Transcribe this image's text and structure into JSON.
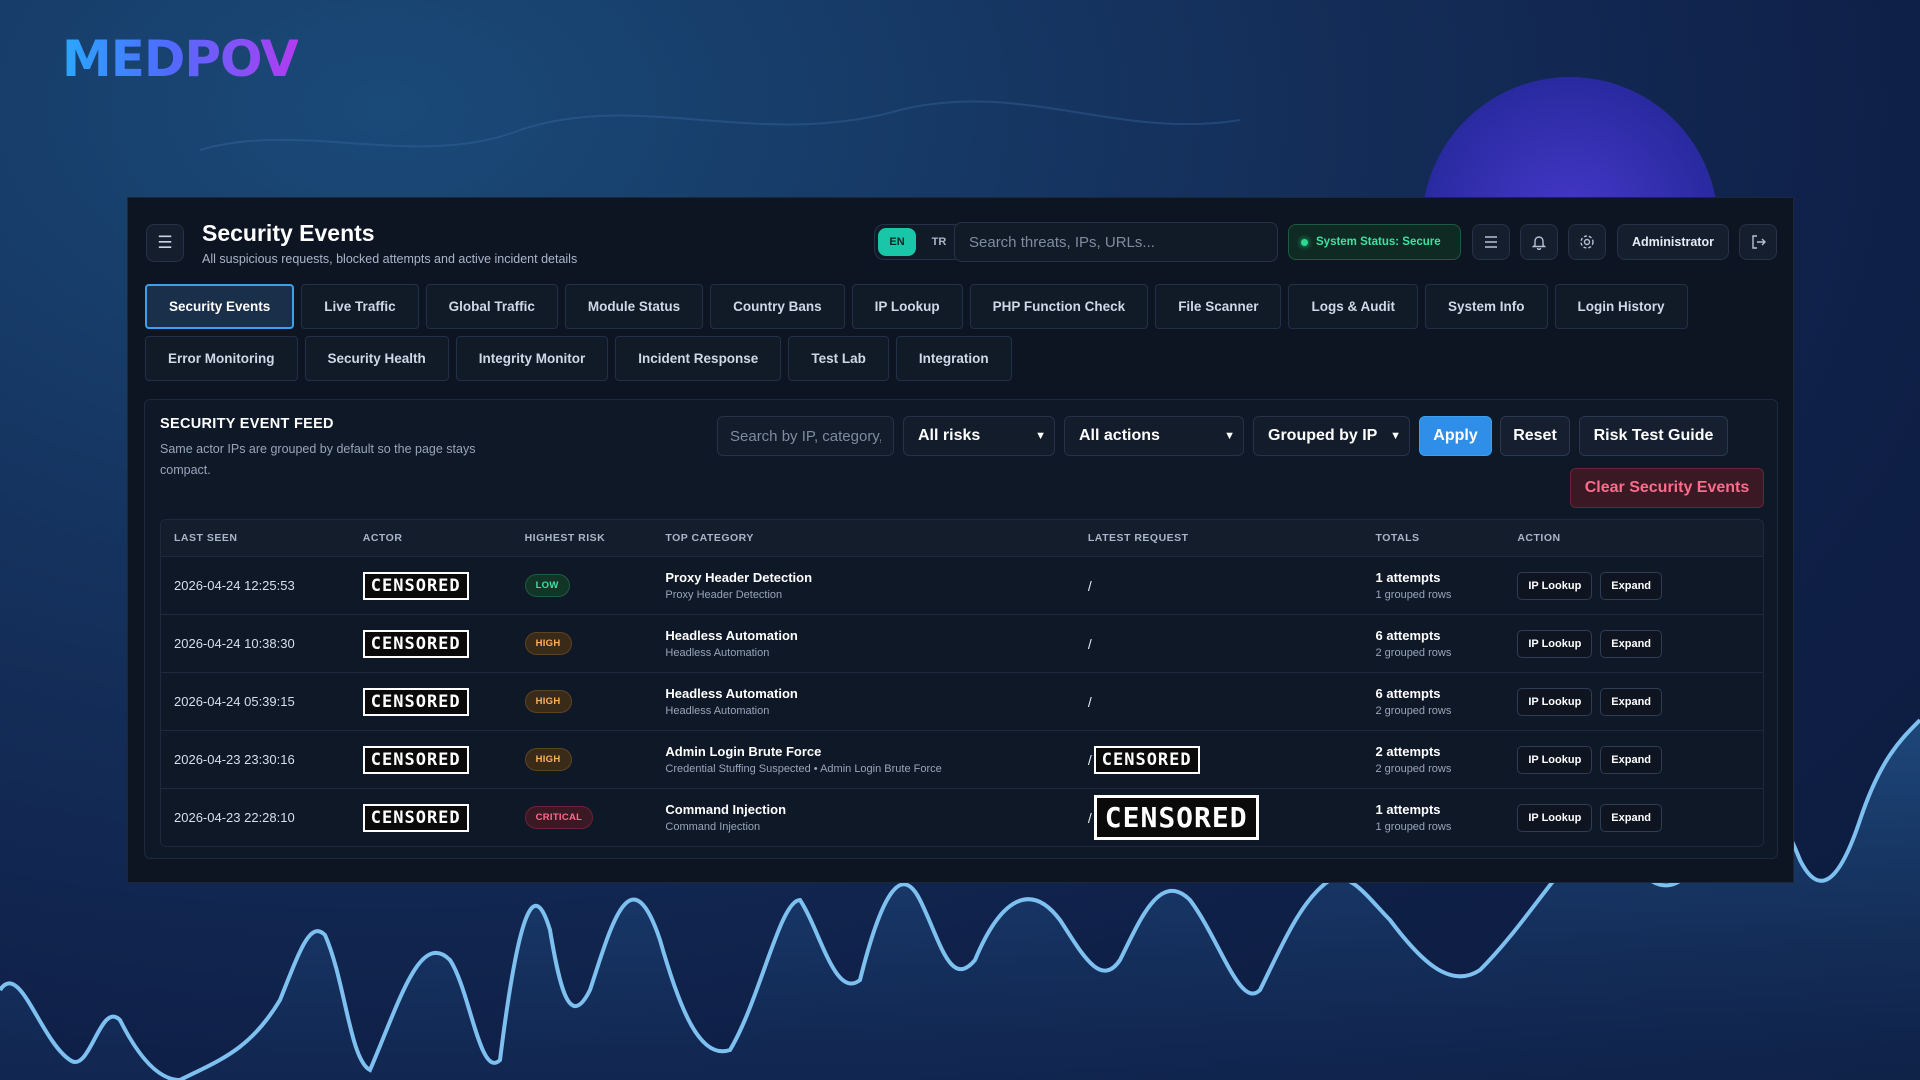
{
  "brand": {
    "logo_text": "MEDPOV"
  },
  "header": {
    "title": "Security Events",
    "subtitle": "All suspicious requests, blocked attempts and active incident details",
    "lang_options": [
      "EN",
      "TR"
    ],
    "search_placeholder": "Search threats, IPs, URLs...",
    "status_text": "System Status: Secure",
    "user_label": "Administrator"
  },
  "tabs": [
    {
      "label": "Security Events",
      "active": true
    },
    {
      "label": "Live Traffic"
    },
    {
      "label": "Global Traffic"
    },
    {
      "label": "Module Status"
    },
    {
      "label": "Country Bans"
    },
    {
      "label": "IP Lookup"
    },
    {
      "label": "PHP Function Check"
    },
    {
      "label": "File Scanner"
    },
    {
      "label": "Logs & Audit"
    },
    {
      "label": "System Info"
    },
    {
      "label": "Login History"
    },
    {
      "label": "Error Monitoring"
    },
    {
      "label": "Security Health"
    },
    {
      "label": "Integrity Monitor"
    },
    {
      "label": "Incident Response"
    },
    {
      "label": "Test Lab"
    },
    {
      "label": "Integration"
    }
  ],
  "feed": {
    "title": "SECURITY EVENT FEED",
    "description": "Same actor IPs are grouped by default so the page stays compact.",
    "filter_placeholder": "Search by IP, category, path",
    "risk_select": "All risks",
    "action_select": "All actions",
    "group_select": "Grouped by IP",
    "apply_label": "Apply",
    "reset_label": "Reset",
    "guide_label": "Risk Test Guide",
    "clear_label": "Clear Security Events"
  },
  "table": {
    "columns": [
      "LAST SEEN",
      "ACTOR",
      "HIGHEST RISK",
      "TOP CATEGORY",
      "LATEST REQUEST",
      "TOTALS",
      "ACTION"
    ],
    "rows": [
      {
        "last_seen": "2026-04-24 12:25:53",
        "actor": "CENSORED",
        "risk": "LOW",
        "risk_level": "low",
        "category": "Proxy Header Detection",
        "category_sub": "Proxy Header Detection",
        "request": "/",
        "request_censored": "",
        "totals": "1 attempts",
        "totals_sub": "1 grouped rows"
      },
      {
        "last_seen": "2026-04-24 10:38:30",
        "actor": "CENSORED",
        "risk": "HIGH",
        "risk_level": "high",
        "category": "Headless Automation",
        "category_sub": "Headless Automation",
        "request": "/",
        "request_censored": "",
        "totals": "6 attempts",
        "totals_sub": "2 grouped rows"
      },
      {
        "last_seen": "2026-04-24 05:39:15",
        "actor": "CENSORED",
        "risk": "HIGH",
        "risk_level": "high",
        "category": "Headless Automation",
        "category_sub": "Headless Automation",
        "request": "/",
        "request_censored": "",
        "totals": "6 attempts",
        "totals_sub": "2 grouped rows"
      },
      {
        "last_seen": "2026-04-23 23:30:16",
        "actor": "CENSORED",
        "risk": "HIGH",
        "risk_level": "high",
        "category": "Admin Login Brute Force",
        "category_sub": "Credential Stuffing Suspected • Admin Login Brute Force",
        "request": "/",
        "request_censored": "CENSORED",
        "totals": "2 attempts",
        "totals_sub": "2 grouped rows"
      },
      {
        "last_seen": "2026-04-23 22:28:10",
        "actor": "CENSORED",
        "risk": "CRITICAL",
        "risk_level": "critical",
        "category": "Command Injection",
        "category_sub": "Command Injection",
        "request": "/",
        "request_censored": "CENSORED",
        "totals": "1 attempts",
        "totals_sub": "1 grouped rows"
      }
    ],
    "action_labels": [
      "IP Lookup",
      "Expand"
    ]
  },
  "colors": {
    "accent": "#2f8fe8",
    "success": "#3fe0a3",
    "danger": "#ff6b8a",
    "warning": "#ffb15a"
  }
}
